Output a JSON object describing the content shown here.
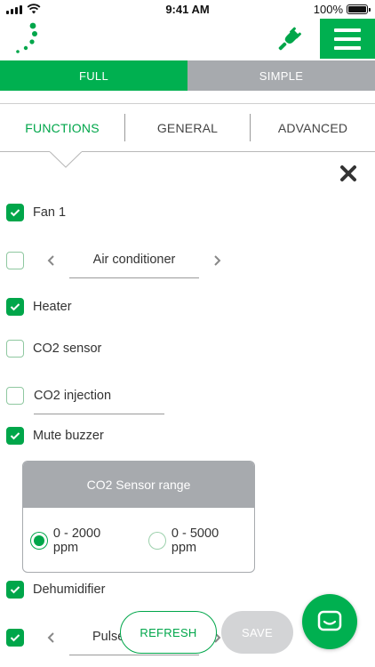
{
  "status_bar": {
    "time": "9:41 AM",
    "battery": "100%",
    "signal_icon": "cell-signal-icon",
    "wifi_icon": "wifi-icon",
    "battery_icon": "battery-icon"
  },
  "header": {
    "logo_icon": "dotted-arc-logo",
    "plug_icon": "plug-icon",
    "menu_icon": "hamburger-menu-icon",
    "accent_color": "#00b050"
  },
  "modes": [
    {
      "label": "FULL",
      "active": true
    },
    {
      "label": "SIMPLE",
      "active": false
    }
  ],
  "sections": [
    {
      "label": "FUNCTIONS",
      "active": true
    },
    {
      "label": "GENERAL",
      "active": false
    },
    {
      "label": "ADVANCED",
      "active": false
    }
  ],
  "functions": {
    "fan1": {
      "label": "Fan 1",
      "checked": true
    },
    "air_conditioner": {
      "value": "Air conditioner",
      "checked": false
    },
    "heater": {
      "label": "Heater",
      "checked": true
    },
    "co2_sensor": {
      "label": "CO2 sensor",
      "checked": false
    },
    "co2_injection": {
      "label": "CO2 injection",
      "checked": false
    },
    "mute_buzzer": {
      "label": "Mute buzzer",
      "checked": true
    },
    "dehumidifier": {
      "label": "Dehumidifier",
      "checked": true
    },
    "pulse": {
      "value": "Pulse",
      "checked": true
    }
  },
  "co2_range": {
    "title": "CO2 Sensor range",
    "options": [
      {
        "label": "0 - 2000 ppm",
        "selected": true
      },
      {
        "label": "0 - 5000 ppm",
        "selected": false
      }
    ]
  },
  "actions": {
    "refresh_label": "REFRESH",
    "save_label": "SAVE",
    "chat_icon": "chat-icon"
  }
}
